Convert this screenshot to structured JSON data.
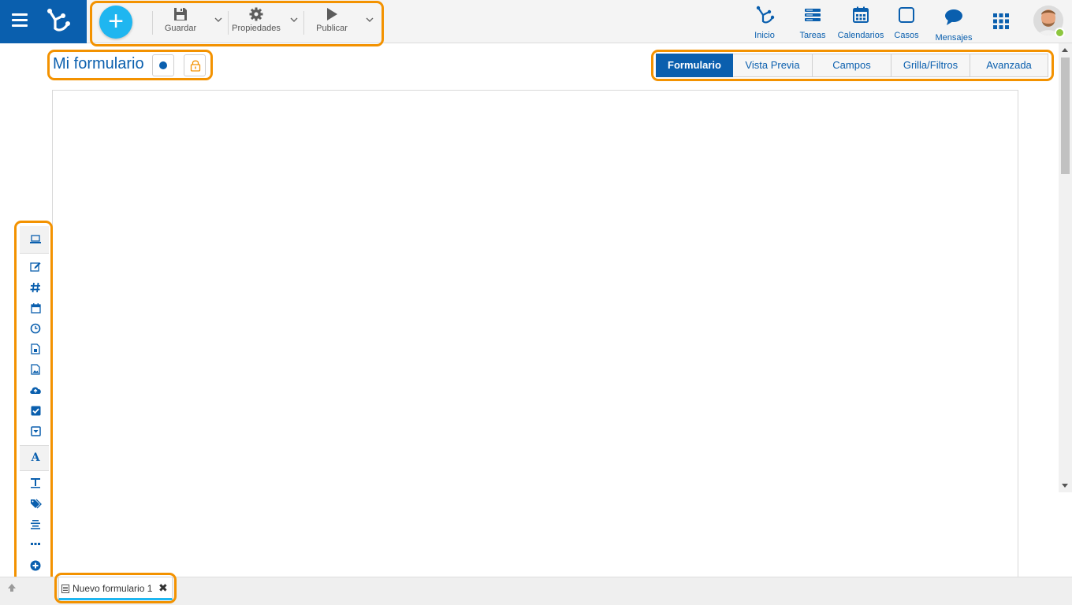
{
  "toolbar": {
    "add_label": "+",
    "save_label": "Guardar",
    "properties_label": "Propiedades",
    "publish_label": "Publicar"
  },
  "nav": [
    {
      "label": "Inicio",
      "icon": "network-icon"
    },
    {
      "label": "Tareas",
      "icon": "tasks-icon"
    },
    {
      "label": "Calendarios",
      "icon": "calendar-icon"
    },
    {
      "label": "Casos",
      "icon": "cases-icon"
    },
    {
      "label": "Mensajes",
      "icon": "message-icon"
    }
  ],
  "form": {
    "title": "Mi formulario"
  },
  "tabs": [
    {
      "label": "Formulario",
      "active": true
    },
    {
      "label": "Vista Previa",
      "active": false
    },
    {
      "label": "Campos",
      "active": false
    },
    {
      "label": "Grilla/Filtros",
      "active": false
    },
    {
      "label": "Avanzada",
      "active": false
    }
  ],
  "palette": {
    "text_section_glyph": "A",
    "items": [
      "monitor-icon",
      "edit-icon",
      "number-icon",
      "calendar-icon",
      "clock-icon",
      "file-icon",
      "image-icon",
      "upload-icon",
      "checkbox-icon",
      "dropdown-icon",
      "text-icon",
      "tag-icon",
      "align-icon",
      "more-icon",
      "plus-circle-icon",
      "cube-icon"
    ]
  },
  "document_tabs": [
    {
      "label": "Nuevo formulario 1",
      "close": "✖"
    }
  ],
  "colors": {
    "brand": "#0a5fae",
    "accent": "#1fb6f0",
    "highlight": "#f39200"
  }
}
